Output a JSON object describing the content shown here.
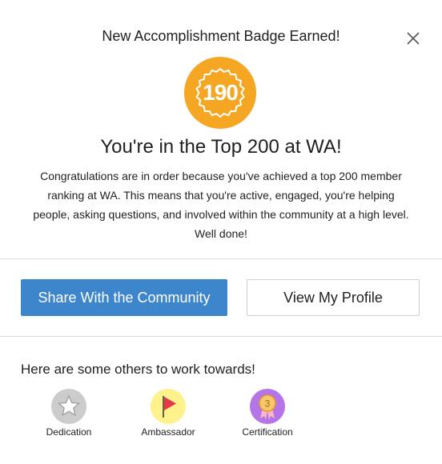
{
  "modal": {
    "header_title": "New Accomplishment Badge Earned!",
    "close_icon": "close-icon",
    "badge": {
      "number": "190",
      "color": "#f5a623",
      "icon": "award-badge-icon"
    },
    "heading": "You're in the Top 200 at WA!",
    "description": "Congratulations are in order because you've achieved a top 200 member ranking at WA. This means that you're active, engaged, you're helping people, asking questions, and involved within the community at a high level. Well done!"
  },
  "actions": {
    "share_label": "Share With the Community",
    "profile_label": "View My Profile",
    "accent_color": "#3d86cc"
  },
  "others": {
    "heading": "Here are some others to work towards!",
    "badges": [
      {
        "label": "Dedication",
        "icon": "star-icon",
        "color": "#cccccc"
      },
      {
        "label": "Ambassador",
        "icon": "flag-icon",
        "color": "#fdf28c"
      },
      {
        "label": "Certification",
        "icon": "ribbon-medal-icon",
        "color": "#b574e8",
        "number": "3"
      }
    ]
  }
}
